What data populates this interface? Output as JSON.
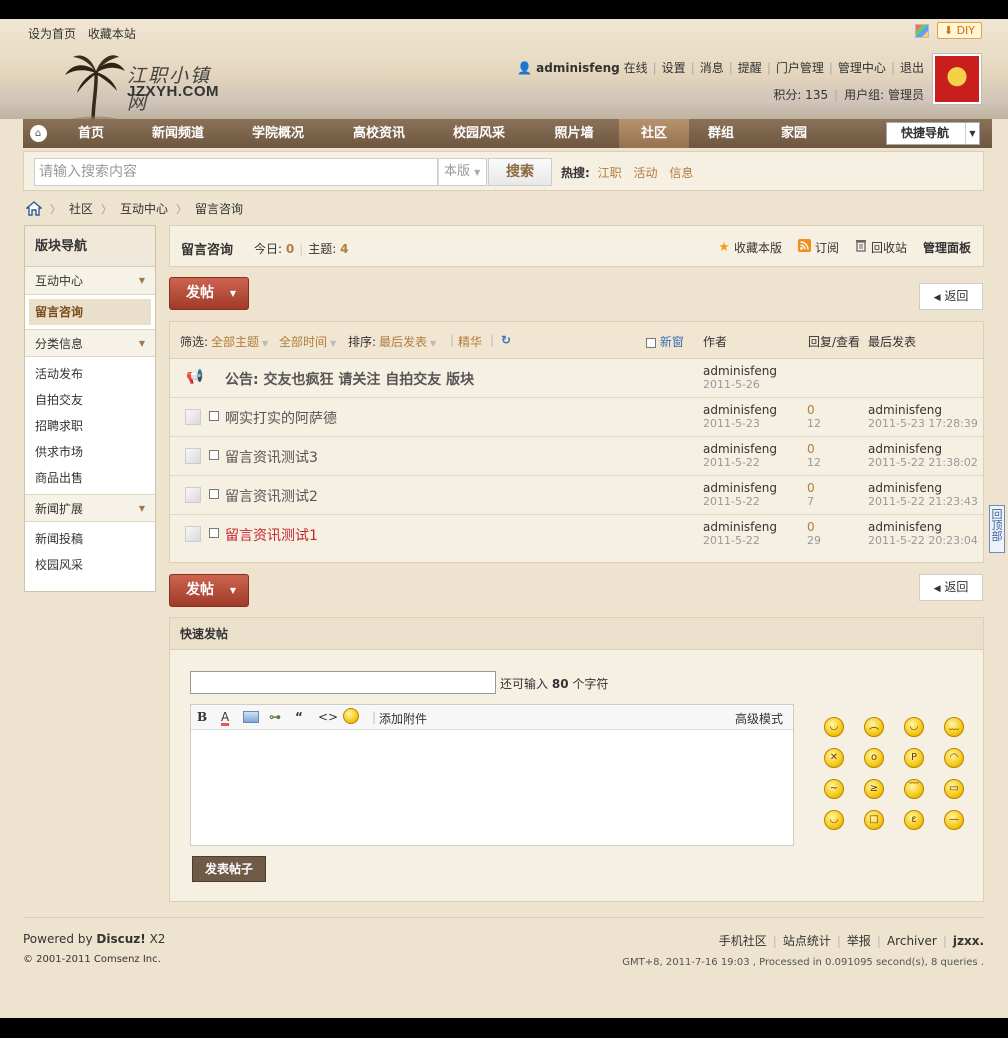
{
  "topbar": {
    "set_home": "设为首页",
    "bookmark": "收藏本站",
    "diy": "DIY"
  },
  "logo": {
    "cn": "江职小镇网",
    "en": "JZXYH.COM"
  },
  "user": {
    "name": "adminisfeng",
    "status": "在线",
    "links": [
      "设置",
      "消息",
      "提醒",
      "门户管理",
      "管理中心",
      "退出"
    ],
    "points_label": "积分: 135",
    "group_label": "用户组: 管理员"
  },
  "nav": {
    "items": [
      "首页",
      "新闻频道",
      "学院概况",
      "高校资讯",
      "校园风采",
      "照片墙",
      "社区",
      "群组",
      "家园"
    ],
    "active": "社区",
    "quick_nav": "快捷导航"
  },
  "search": {
    "placeholder": "请输入搜索内容",
    "scope": "本版",
    "button": "搜索",
    "hot_label": "热搜:",
    "hot": [
      "江职",
      "活动",
      "信息"
    ]
  },
  "breadcrumb": [
    "社区",
    "互动中心",
    "留言咨询"
  ],
  "leftnav": {
    "title": "版块导航",
    "groups": [
      {
        "name": "互动中心",
        "items": [
          "留言咨询"
        ]
      },
      {
        "name": "分类信息",
        "items": [
          "活动发布",
          "自拍交友",
          "招聘求职",
          "供求市场",
          "商品出售"
        ]
      },
      {
        "name": "新闻扩展",
        "items": [
          "新闻投稿",
          "校园风采"
        ]
      }
    ]
  },
  "forum": {
    "name": "留言咨询",
    "today_label": "今日:",
    "today": "0",
    "threads_label": "主题:",
    "threads": "4",
    "actions": {
      "favorite": "收藏本版",
      "subscribe": "订阅",
      "recycle": "回收站",
      "admin": "管理面板"
    }
  },
  "buttons": {
    "post": "发帖",
    "back": "返回"
  },
  "list": {
    "filter_label": "筛选:",
    "all_topics": "全部主题",
    "all_time": "全部时间",
    "sort_label": "排序:",
    "last_post": "最后发表",
    "digest": "精华",
    "new_window": "新窗",
    "col_author": "作者",
    "col_replies": "回复/查看",
    "col_last": "最后发表",
    "notice": {
      "text": "公告: 交友也疯狂 请关注 自拍交友 版块",
      "author": "adminisfeng",
      "date": "2011-5-26"
    },
    "threads": [
      {
        "subject": "啊实打实的阿萨德",
        "author": "adminisfeng",
        "date": "2011-5-23",
        "replies": "0",
        "views": "12",
        "last_user": "adminisfeng",
        "last_time": "2011-5-23 17:28:39",
        "highlight": false
      },
      {
        "subject": "留言资讯测试3",
        "author": "adminisfeng",
        "date": "2011-5-22",
        "replies": "0",
        "views": "12",
        "last_user": "adminisfeng",
        "last_time": "2011-5-22 21:38:02",
        "highlight": false
      },
      {
        "subject": "留言资讯测试2",
        "author": "adminisfeng",
        "date": "2011-5-22",
        "replies": "0",
        "views": "7",
        "last_user": "adminisfeng",
        "last_time": "2011-5-22 21:23:43",
        "highlight": false
      },
      {
        "subject": "留言资讯测试1",
        "author": "adminisfeng",
        "date": "2011-5-22",
        "replies": "0",
        "views": "29",
        "last_user": "adminisfeng",
        "last_time": "2011-5-22 20:23:04",
        "highlight": true
      }
    ]
  },
  "quickpost": {
    "title": "快速发帖",
    "remain_prefix": "还可输入",
    "remain_count": "80",
    "remain_suffix": "个字符",
    "attach": "添加附件",
    "advanced": "高级模式",
    "submit": "发表帖子"
  },
  "totop": "回顶部",
  "footer": {
    "powered_prefix": "Powered by",
    "powered_brand": "Discuz!",
    "powered_ver": "X2",
    "copyright": "© 2001-2011 Comsenz Inc.",
    "links": [
      "手机社区",
      "站点统计",
      "举报",
      "Archiver",
      "jzxx."
    ],
    "gen": "GMT+8, 2011-7-16 19:03 , Processed in 0.091095 second(s), 8 queries ."
  }
}
